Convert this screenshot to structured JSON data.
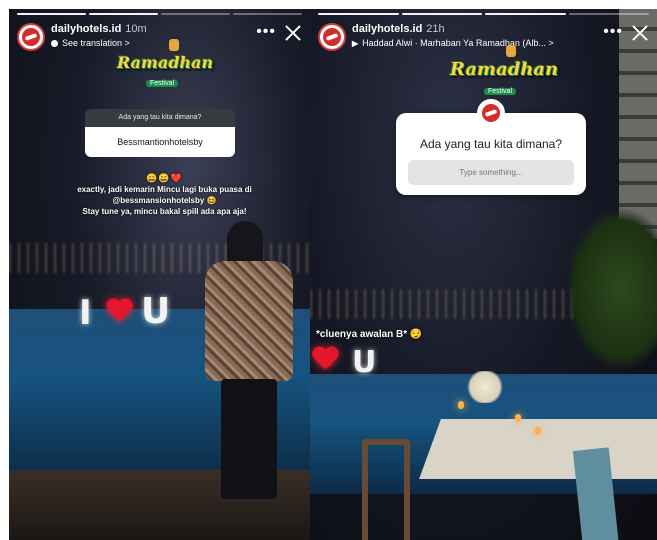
{
  "left_story": {
    "username": "dailyhotels.id",
    "time": "10m",
    "subline": "See translation >",
    "festival": {
      "title": "Ramadhan",
      "sub": "Festival"
    },
    "question": {
      "prompt": "Ada yang tau kita dimana?",
      "answer": "Bessmantionhotelsby"
    },
    "caption": {
      "emojis": "😄😄❤️",
      "line1": "exactly, jadi kemarin Mincu lagi buka puasa di",
      "line2": "@bessmansionhotelsby 😆",
      "line3": "Stay tune ya, mincu bakal spill ada apa aja!"
    },
    "sign": {
      "i": "I",
      "u": "U"
    }
  },
  "right_story": {
    "username": "dailyhotels.id",
    "time": "21h",
    "music_icon": "▶︎",
    "music": "Haddad Alwi · Marhaban Ya Ramadhan (Alb... >",
    "festival": {
      "title": "Ramadhan",
      "sub": "Festival"
    },
    "question": {
      "prompt": "Ada yang tau kita dimana?",
      "placeholder": "Type something..."
    },
    "clue": "*cluenya awalan B* 😏",
    "sign": {
      "u": "U"
    }
  },
  "icons": {
    "more": "•••",
    "close": "close-icon",
    "avatar": "brand-logo"
  },
  "colors": {
    "heart": "#e3162b",
    "festival_text": "#ffd23f",
    "card_bg": "#ffffff"
  }
}
